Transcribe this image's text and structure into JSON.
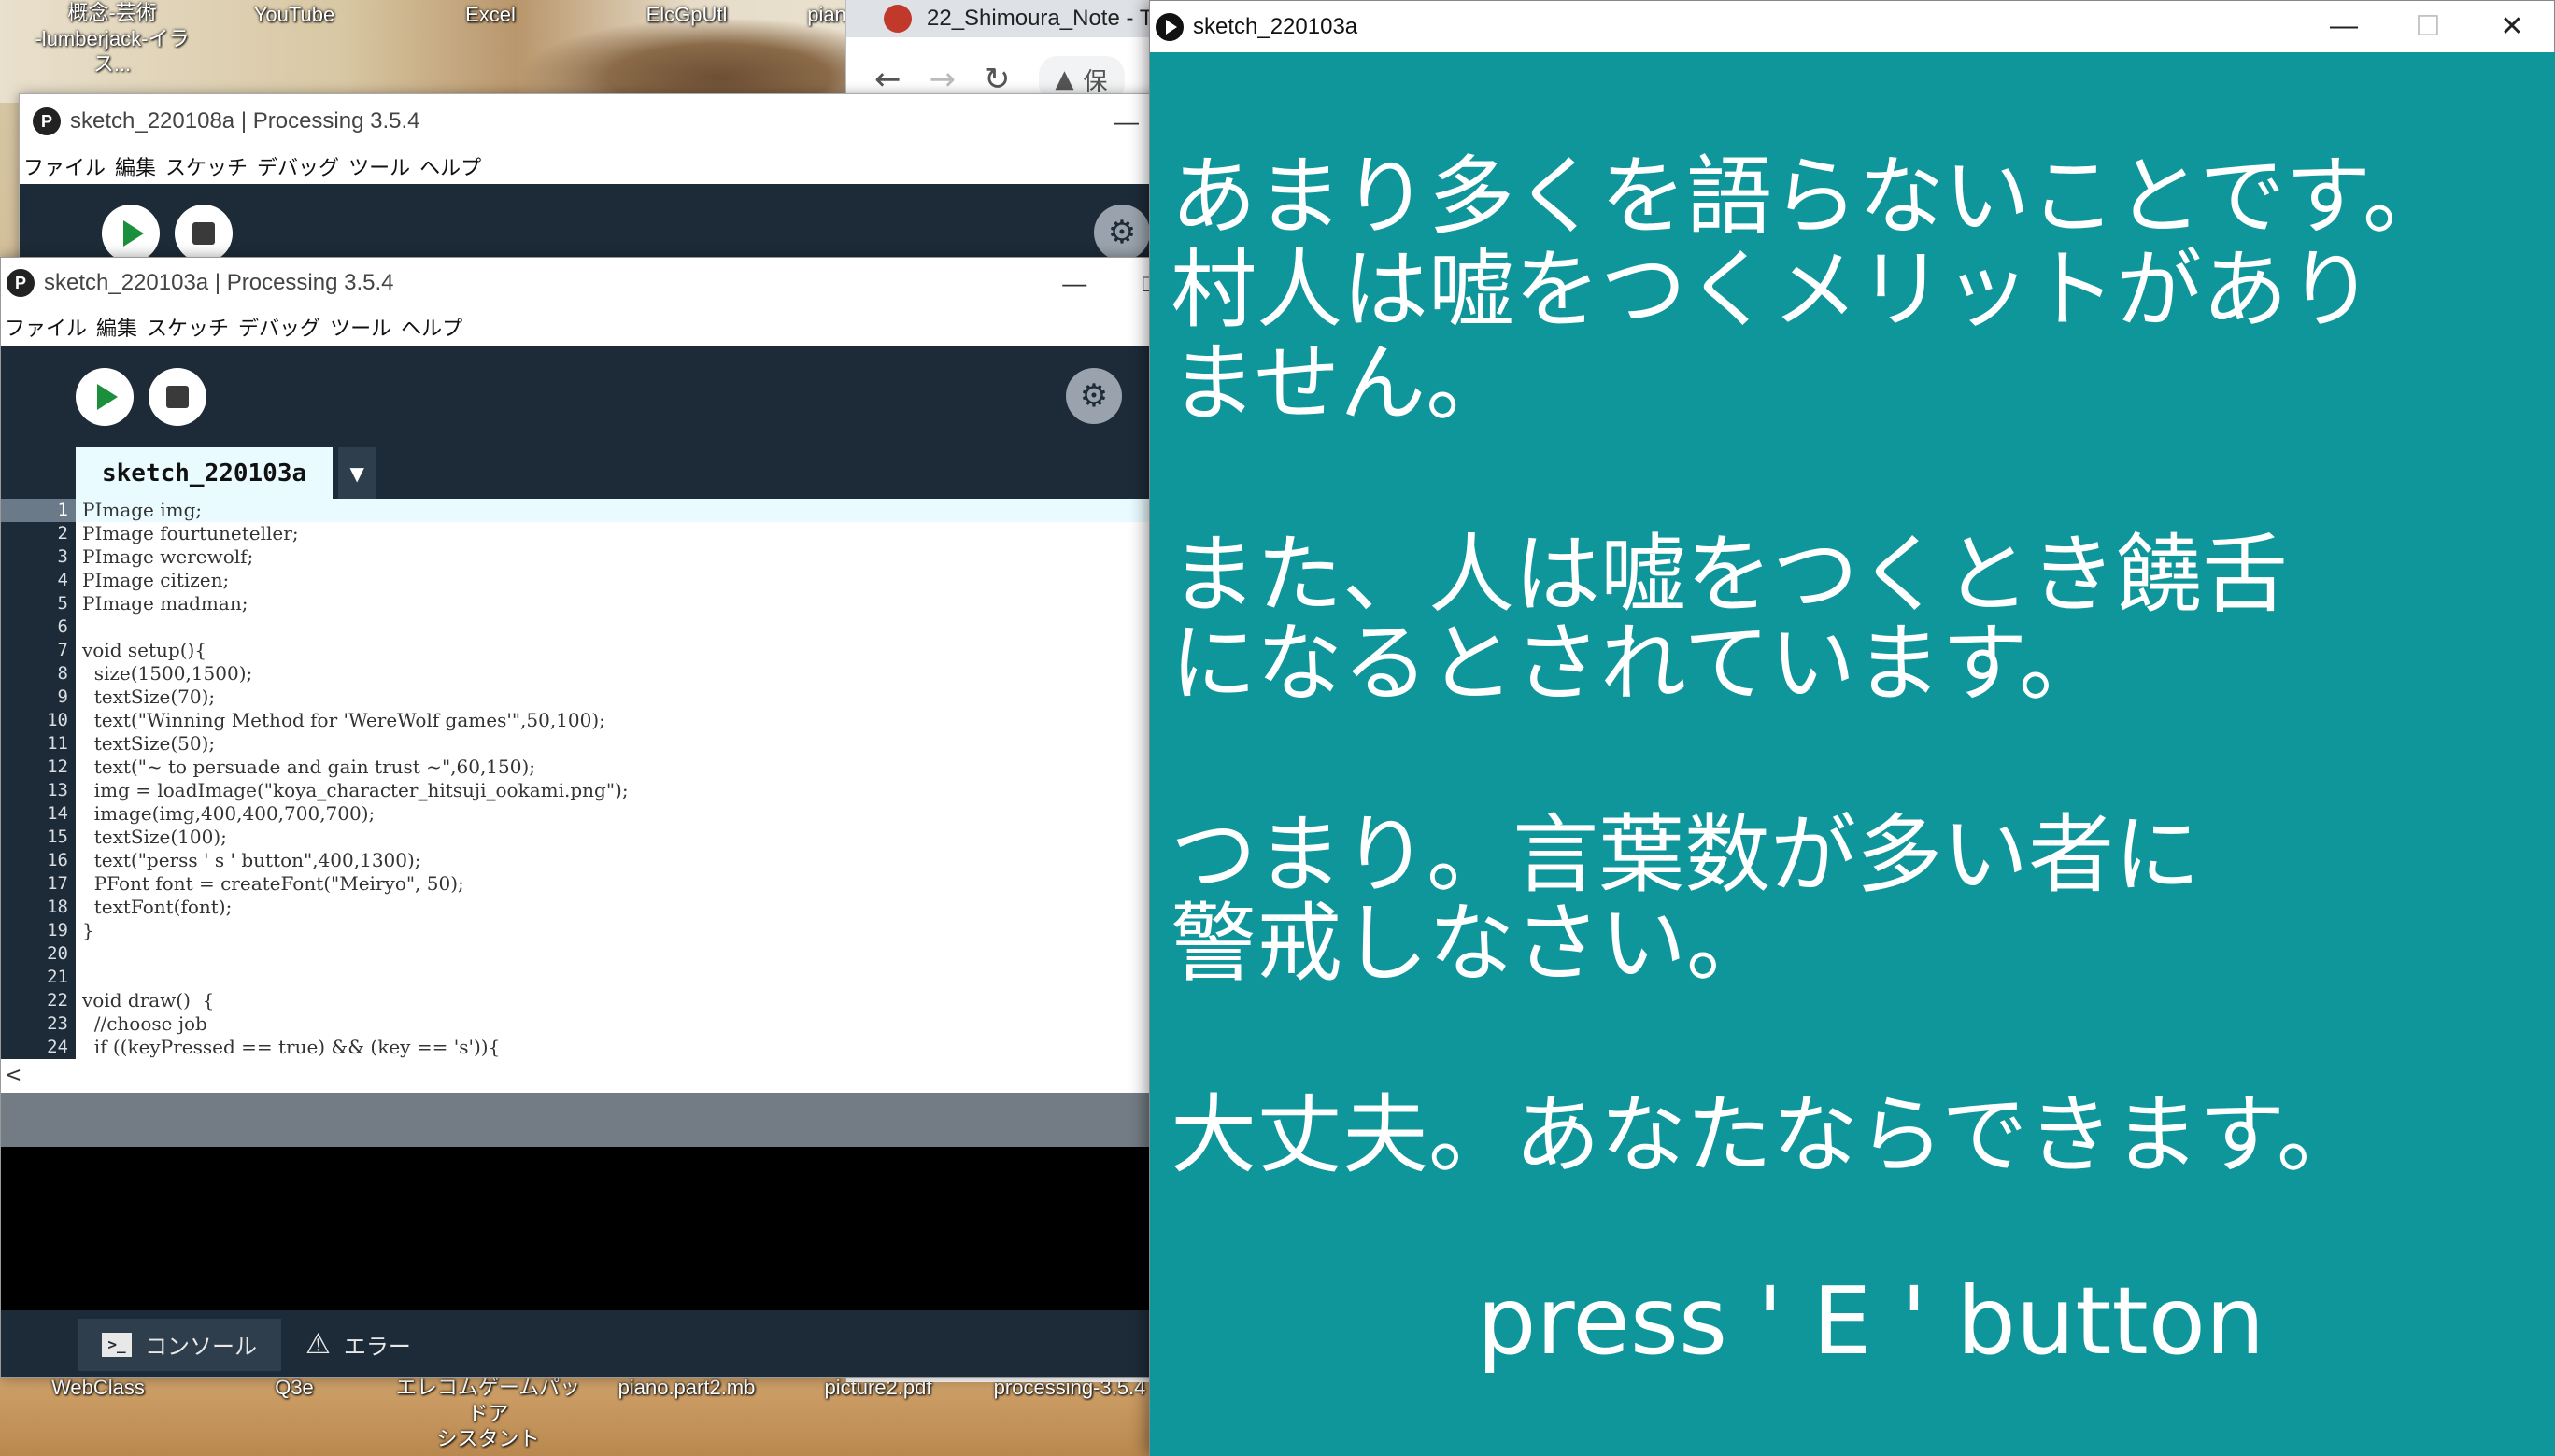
{
  "desktop": {
    "top_icons": [
      {
        "label": "概念-芸術\n-lumberjack-イラス..."
      },
      {
        "label": "YouTube"
      },
      {
        "label": "Excel"
      },
      {
        "label": "ElcGpUtl"
      },
      {
        "label": "pian"
      }
    ],
    "bottom_icons": [
      {
        "label": "WebClass"
      },
      {
        "label": "Q3e"
      },
      {
        "label": "エレコムゲームパッドア\nシスタント"
      },
      {
        "label": "piano.part2.mb"
      },
      {
        "label": "picture2.pdf"
      },
      {
        "label": "processing-3.5.4"
      }
    ]
  },
  "chrome": {
    "tab_title": "22_Shimoura_Note - T",
    "address_partial": "保",
    "back_icon": "arrow-left",
    "forward_icon": "arrow-right",
    "reload_icon": "reload"
  },
  "ide_back": {
    "title": "sketch_220108a | Processing 3.5.4",
    "logo": "P",
    "minimize": "—",
    "menu": [
      "ファイル",
      "編集",
      "スケッチ",
      "デバッグ",
      "ツール",
      "ヘルプ"
    ]
  },
  "ide_front": {
    "title": "sketch_220103a | Processing 3.5.4",
    "logo": "P",
    "minimize": "—",
    "maximize": "□",
    "menu": [
      "ファイル",
      "編集",
      "スケッチ",
      "デバッグ",
      "ツール",
      "ヘルプ"
    ],
    "tab_name": "sketch_220103a",
    "tab_arrow": "▼",
    "debug_label": "⚙",
    "scroll_left": "<",
    "console_tab": "コンソール",
    "error_tab": "エラー",
    "console_icon": ">_",
    "warn_icon": "⚠",
    "code": [
      {
        "n": "1",
        "text": "PImage img;"
      },
      {
        "n": "2",
        "text": "PImage fourtuneteller;"
      },
      {
        "n": "3",
        "text": "PImage werewolf;"
      },
      {
        "n": "4",
        "text": "PImage citizen;"
      },
      {
        "n": "5",
        "text": "PImage madman;"
      },
      {
        "n": "6",
        "text": ""
      },
      {
        "n": "7",
        "text": "void setup(){"
      },
      {
        "n": "8",
        "text": "  size(1500,1500);"
      },
      {
        "n": "9",
        "text": "  textSize(70);"
      },
      {
        "n": "10",
        "text": "  text(\"Winning Method for 'WereWolf games'\",50,100);"
      },
      {
        "n": "11",
        "text": "  textSize(50);"
      },
      {
        "n": "12",
        "text": "  text(\"~ to persuade and gain trust ~\",60,150);"
      },
      {
        "n": "13",
        "text": "  img = loadImage(\"koya_character_hitsuji_ookami.png\");"
      },
      {
        "n": "14",
        "text": "  image(img,400,400,700,700);"
      },
      {
        "n": "15",
        "text": "  textSize(100);"
      },
      {
        "n": "16",
        "text": "  text(\"perss ' s ' button\",400,1300);"
      },
      {
        "n": "17",
        "text": "  PFont font = createFont(\"Meiryo\", 50);"
      },
      {
        "n": "18",
        "text": "  textFont(font);"
      },
      {
        "n": "19",
        "text": "}"
      },
      {
        "n": "20",
        "text": ""
      },
      {
        "n": "21",
        "text": ""
      },
      {
        "n": "22",
        "text": "void draw()  {"
      },
      {
        "n": "23",
        "text": "  //choose job"
      },
      {
        "n": "24",
        "text": "  if ((keyPressed == true) && (key == 's')){"
      }
    ]
  },
  "sketch_window": {
    "title": "sketch_220103a",
    "minimize": "—",
    "maximize": "☐",
    "close": "✕",
    "background_color": "#0f969b",
    "lines": [
      "あまり多くを語らないことです。",
      "村人は嘘をつくメリットがあり",
      "ません。",
      "",
      "また、人は嘘をつくとき饒舌",
      "になるとされています。",
      "",
      "つまり。言葉数が多い者に",
      "警戒しなさい。",
      "",
      "大丈夫。あなたならできます。"
    ],
    "press_text": "press ' E ' button"
  }
}
